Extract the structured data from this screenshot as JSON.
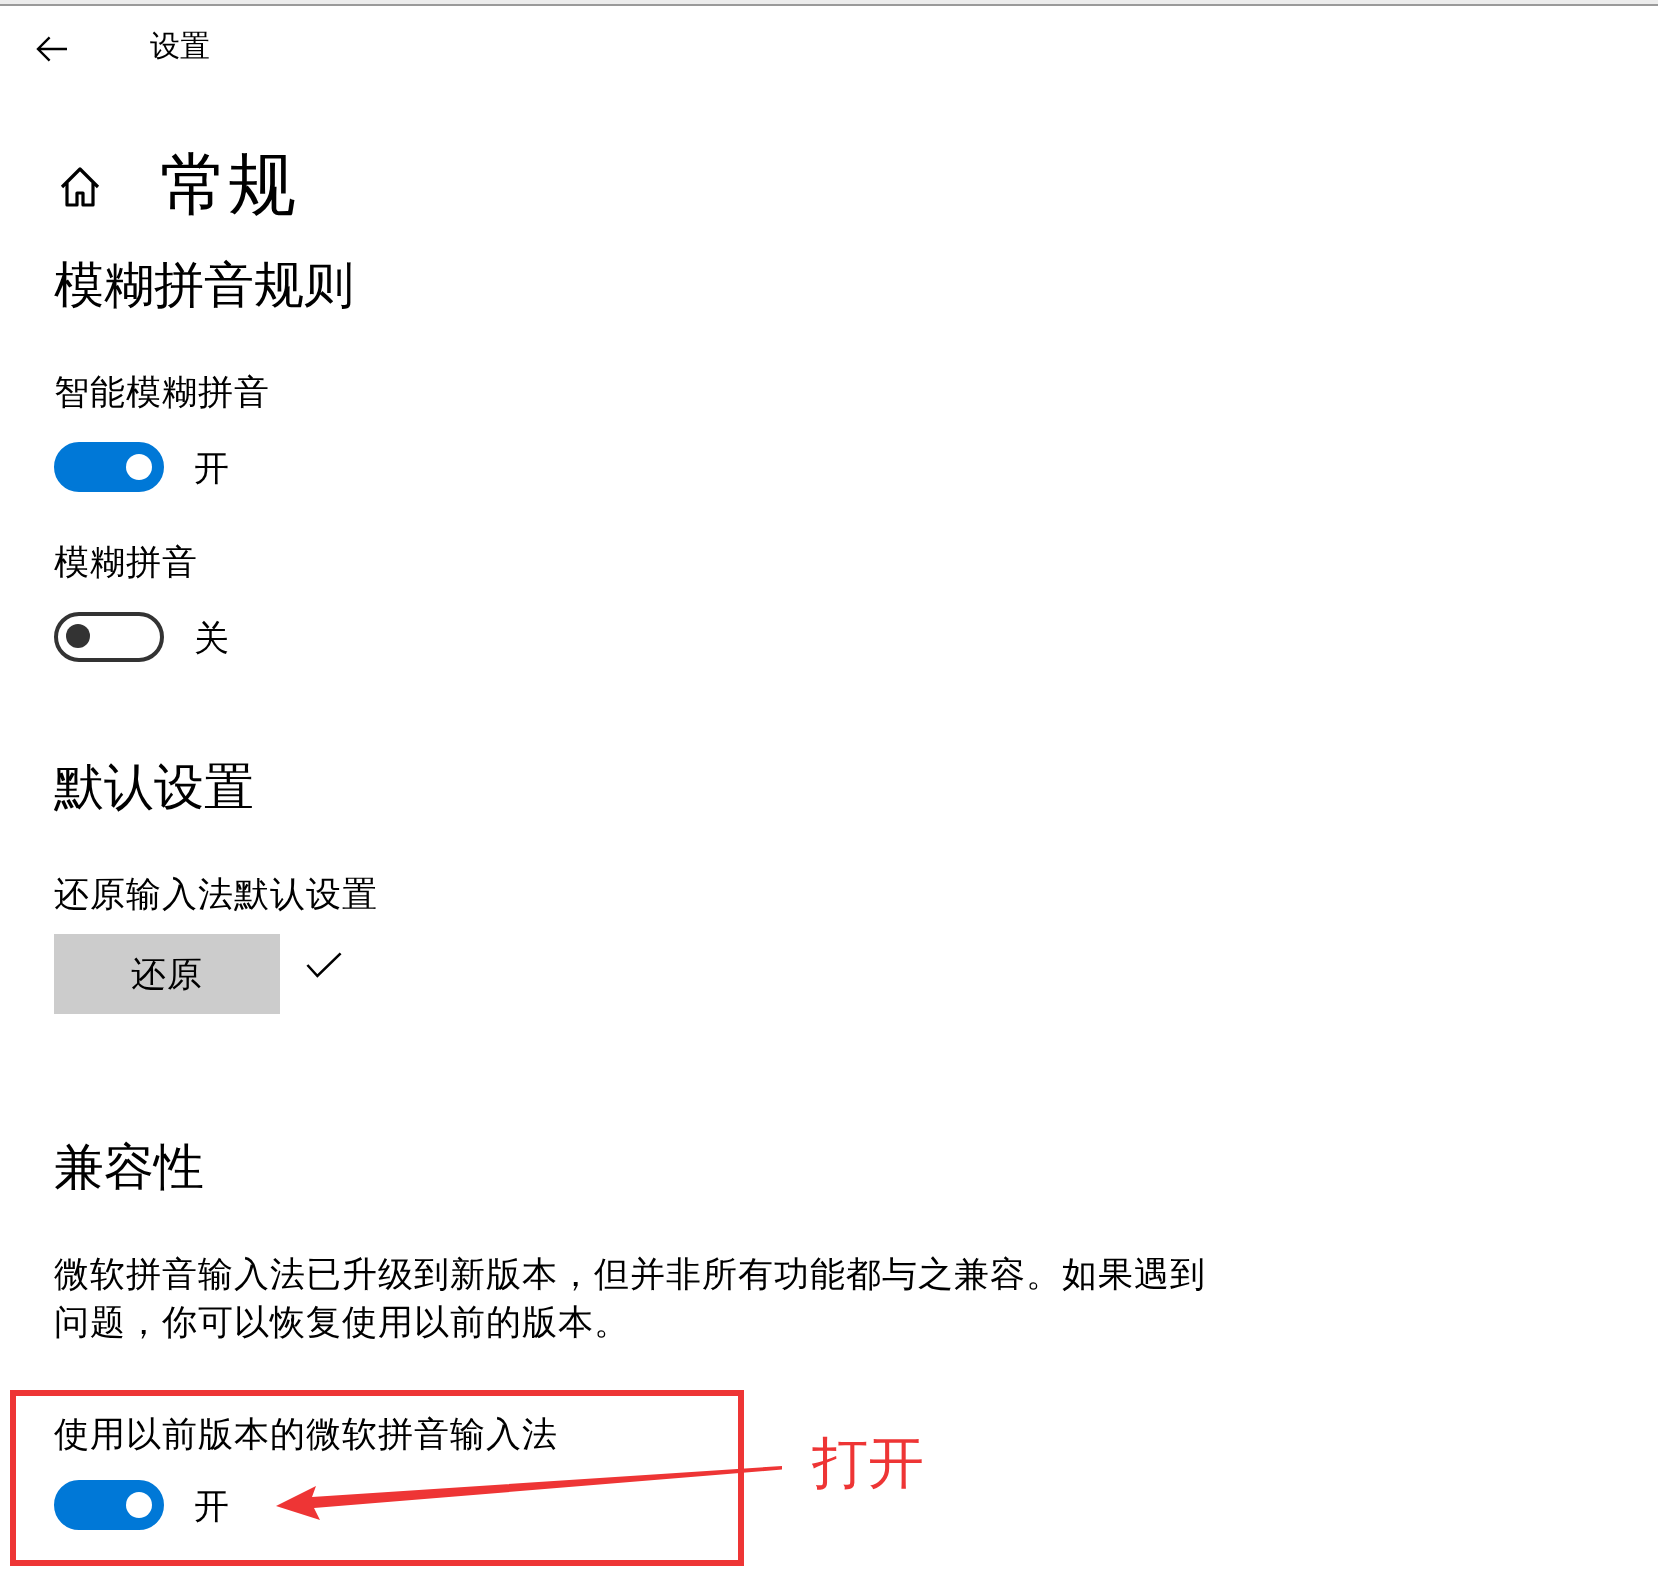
{
  "header": {
    "title": "设置"
  },
  "page": {
    "title": "常规"
  },
  "sections": [
    {
      "heading": "模糊拼音规则",
      "settings": [
        {
          "kind": "toggle",
          "label": "智能模糊拼音",
          "on": true,
          "state_text": "开",
          "highlighted": false
        },
        {
          "kind": "toggle",
          "label": "模糊拼音",
          "on": false,
          "state_text": "关",
          "highlighted": false
        }
      ]
    },
    {
      "heading": "默认设置",
      "settings": [
        {
          "kind": "button",
          "label": "还原输入法默认设置",
          "button_label": "还原",
          "done": true,
          "highlighted": false
        }
      ]
    },
    {
      "heading": "兼容性",
      "description": "微软拼音输入法已升级到新版本，但并非所有功能都与之兼容。如果遇到问题，你可以恢复使用以前的版本。",
      "settings": [
        {
          "kind": "toggle",
          "label": "使用以前版本的微软拼音输入法",
          "on": true,
          "state_text": "开",
          "highlighted": true
        }
      ]
    }
  ],
  "annotation": {
    "text": "打开"
  }
}
